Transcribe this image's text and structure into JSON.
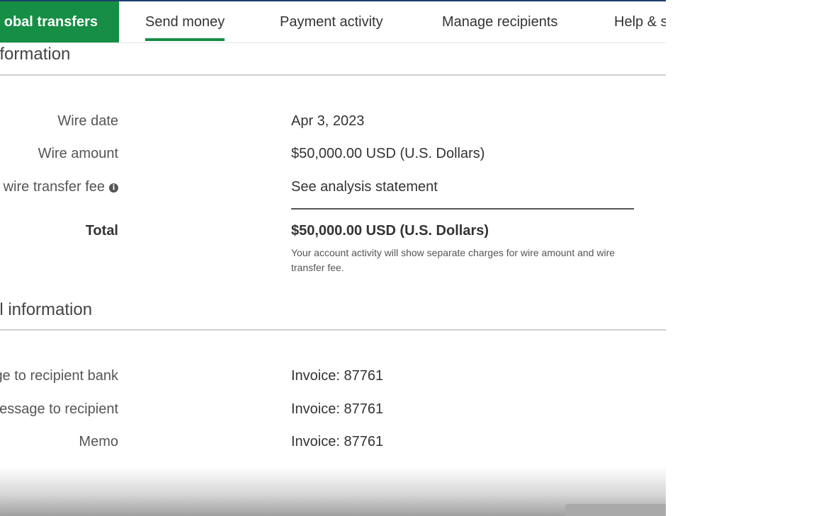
{
  "nav": {
    "active": "obal transfers",
    "items": [
      "Send money",
      "Payment activity",
      "Manage recipients",
      "Help & s"
    ]
  },
  "section1": {
    "title": "nformation",
    "rows": [
      {
        "label": "Wire date",
        "value": "Apr 3, 2023"
      },
      {
        "label": "Wire amount",
        "value": "$50,000.00 USD (U.S. Dollars)"
      },
      {
        "label": "Outgoing wire transfer fee",
        "value": "See analysis statement"
      }
    ],
    "total_label": "Total",
    "total_value": "$50,000.00  USD (U.S. Dollars)",
    "note": "Your account activity will show separate charges for wire amount and wire transfer fee."
  },
  "section2": {
    "title": "al information",
    "rows": [
      {
        "label": "Message to recipient bank",
        "value": "Invoice: 87761"
      },
      {
        "label": "Message to recipient",
        "value": "Invoice: 87761"
      },
      {
        "label": "Memo",
        "value": "Invoice: 87761"
      }
    ]
  },
  "colors": {
    "accent_green": "#168e45",
    "top_strip": "#1a3f6b"
  }
}
